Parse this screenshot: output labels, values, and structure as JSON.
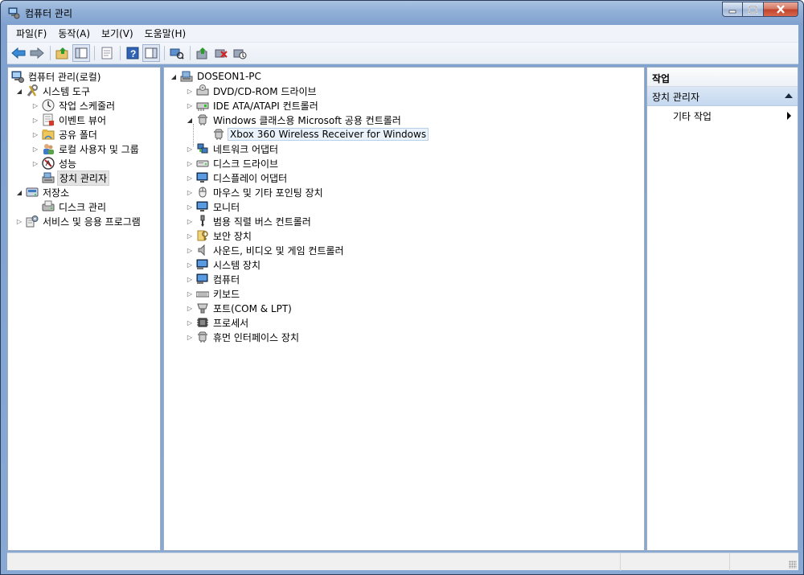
{
  "window": {
    "title": "컴퓨터 관리"
  },
  "menubar": {
    "items": [
      "파일(F)",
      "동작(A)",
      "보기(V)",
      "도움말(H)"
    ]
  },
  "toolbar": {
    "buttons": [
      "back-icon",
      "forward-icon",
      "up-folder-icon",
      "show-hide-tree-icon",
      "export-icon",
      "help-icon",
      "show-hide-action-icon",
      "scan-hardware-icon",
      "update-driver-icon",
      "uninstall-icon",
      "disable-icon"
    ]
  },
  "left_tree": {
    "root": "컴퓨터 관리(로컬)",
    "system_tools": "시스템 도구",
    "task_scheduler": "작업 스케줄러",
    "event_viewer": "이벤트 뷰어",
    "shared_folders": "공유 폴더",
    "local_users": "로컬 사용자 및 그룹",
    "performance": "성능",
    "device_manager": "장치 관리자",
    "storage": "저장소",
    "disk_management": "디스크 관리",
    "services": "서비스 및 응용 프로그램"
  },
  "device_tree": {
    "computer": "DOSEON1-PC",
    "items": [
      "DVD/CD-ROM 드라이브",
      "IDE ATA/ATAPI 컨트롤러",
      "Windows 클래스용 Microsoft 공용 컨트롤러",
      "Xbox 360 Wireless Receiver for Windows",
      "네트워크 어댑터",
      "디스크 드라이브",
      "디스플레이 어댑터",
      "마우스 및 기타 포인팅 장치",
      "모니터",
      "범용 직렬 버스 컨트롤러",
      "보안 장치",
      "사운드, 비디오 및 게임 컨트롤러",
      "시스템 장치",
      "컴퓨터",
      "키보드",
      "포트(COM & LPT)",
      "프로세서",
      "휴먼 인터페이스 장치"
    ]
  },
  "actions": {
    "header": "작업",
    "section": "장치 관리자",
    "item": "기타 작업"
  },
  "colors": {
    "selection": "#eaf3fc",
    "section": "#c5d8ef",
    "titlebar": "#93b1d8"
  }
}
